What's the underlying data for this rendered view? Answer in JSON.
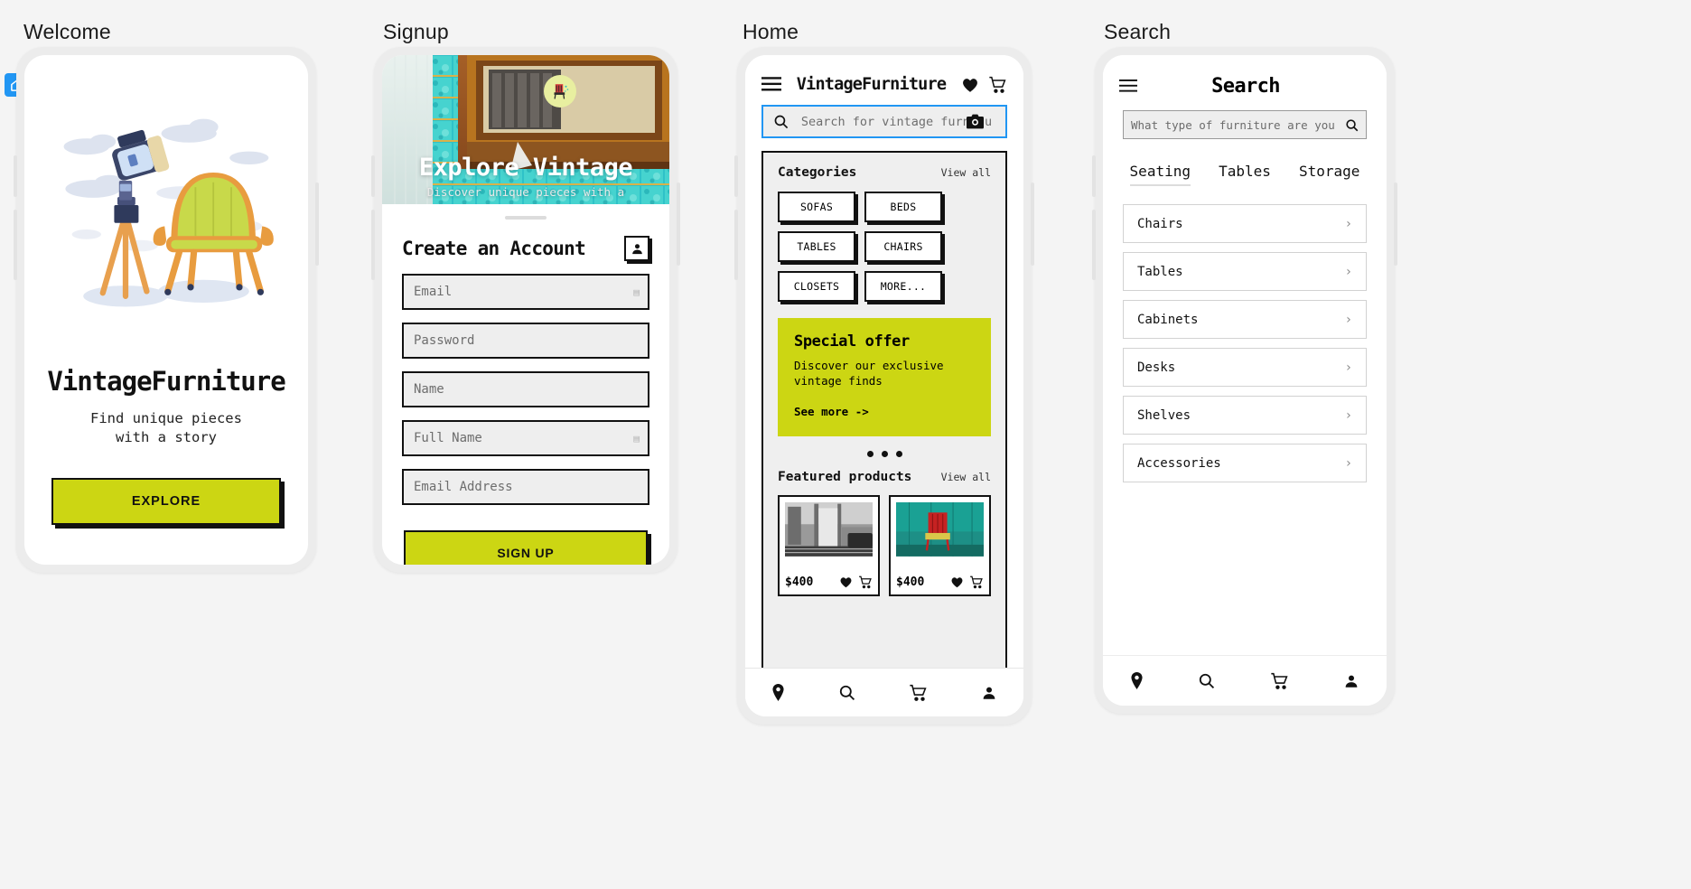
{
  "frames": [
    {
      "label": "Welcome"
    },
    {
      "label": "Signup"
    },
    {
      "label": "Home"
    },
    {
      "label": "Search"
    }
  ],
  "welcome": {
    "title": "VintageFurniture",
    "subtitle": "Find unique pieces with a story",
    "cta": "EXPLORE",
    "illustration_alt": "camera-tripod-and-chair-illustration"
  },
  "signup": {
    "hero_title": "Explore Vintage",
    "hero_subtitle": "Discover unique pieces with a",
    "heading": "Create an Account",
    "profile_icon": "person-icon",
    "fields": [
      {
        "placeholder": "Email",
        "hint": "▤"
      },
      {
        "placeholder": "Password",
        "hint": ""
      },
      {
        "placeholder": "Name",
        "hint": ""
      },
      {
        "placeholder": "Full Name",
        "hint": "▤"
      },
      {
        "placeholder": "Email Address",
        "hint": ""
      }
    ],
    "submit": "SIGN UP"
  },
  "home": {
    "menu_icon": "hamburger-menu-icon",
    "brand": "VintageFurniture",
    "favorites_icon": "heart-icon",
    "cart_icon": "cart-icon",
    "search_placeholder": "Search for vintage furnitu",
    "search_icon": "search-icon",
    "camera_icon": "camera-icon",
    "categories": {
      "title": "Categories",
      "view_all": "View all",
      "chips": [
        "SOFAS",
        "BEDS",
        "TABLES",
        "CHAIRS",
        "CLOSETS",
        "MORE..."
      ]
    },
    "offer": {
      "title": "Special offer",
      "description": "Discover our exclusive vintage finds",
      "link": "See more ->",
      "dots": 3
    },
    "featured": {
      "title": "Featured products",
      "view_all": "View all",
      "products": [
        {
          "price": "$400",
          "image_alt": "black-white-porch-bench",
          "heart": "heart-icon",
          "cart": "cart-icon"
        },
        {
          "price": "$400",
          "image_alt": "red-chair-teal-wall",
          "heart": "heart-icon",
          "cart": "cart-icon"
        }
      ]
    },
    "tabbar": [
      "location-pin-icon",
      "search-icon",
      "cart-icon",
      "person-icon"
    ]
  },
  "search": {
    "menu_icon": "hamburger-menu-icon",
    "title": "Search",
    "input_placeholder": "What type of furniture are you looking",
    "search_icon": "search-icon",
    "tabs": [
      {
        "label": "Seating",
        "active": true
      },
      {
        "label": "Tables",
        "active": false
      },
      {
        "label": "Storage",
        "active": false
      }
    ],
    "items": [
      "Chairs",
      "Tables",
      "Cabinets",
      "Desks",
      "Shelves",
      "Accessories"
    ],
    "chevron": "›",
    "tabbar": [
      "location-pin-icon",
      "search-icon",
      "cart-icon",
      "person-icon"
    ]
  },
  "colors": {
    "accent": "#ccd613",
    "ink": "#111111",
    "focus": "#2196f3",
    "page_bg": "#f4f4f4"
  }
}
